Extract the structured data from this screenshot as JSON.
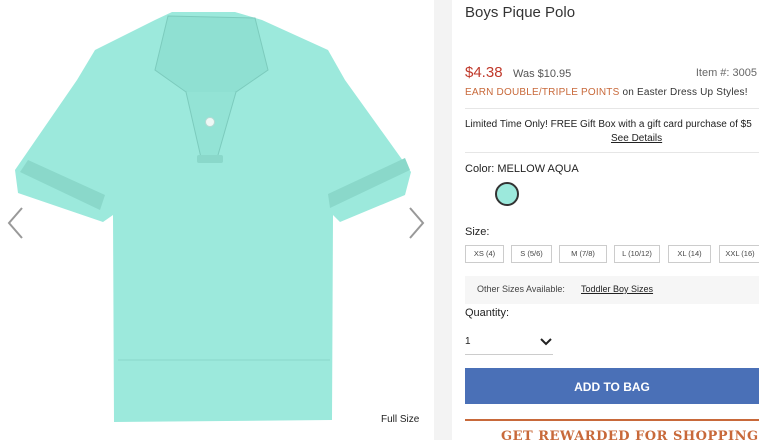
{
  "gallery": {
    "image_alt": "Boys Pique Polo in Mellow Aqua",
    "prev_icon": "chevron-left-icon",
    "next_icon": "chevron-right-icon",
    "full_size_label": "Full Size"
  },
  "product": {
    "title": "Boys Pique Polo",
    "price": "$4.38",
    "was_price": "Was $10.95",
    "item_number": "Item #: 3005",
    "promo_highlight": "EARN DOUBLE/TRIPLE POINTS",
    "promo_rest": " on Easter Dress Up Styles!",
    "gift_text": "Limited Time Only! FREE Gift Box with a gift card purchase of $5",
    "gift_link": "See Details",
    "color_label": "Color: MELLOW AQUA",
    "swatch_color": "#9ce9dc",
    "size_label": "Size:",
    "sizes": [
      "XS (4)",
      "S (5/6)",
      "M (7/8)",
      "L (10/12)",
      "XL (14)",
      "XXL (16)"
    ],
    "other_sizes_label": "Other Sizes Available:",
    "other_sizes_link": "Toddler Boy Sizes",
    "quantity_label": "Quantity:",
    "quantity_value": "1",
    "add_to_bag": "ADD TO BAG",
    "reward_banner": "GET REWARDED FOR SHOPPING"
  },
  "colors": {
    "price": "#c0392b",
    "accent": "#c8693a",
    "button": "#4a70b7",
    "shirt": "#9ce9dc"
  }
}
